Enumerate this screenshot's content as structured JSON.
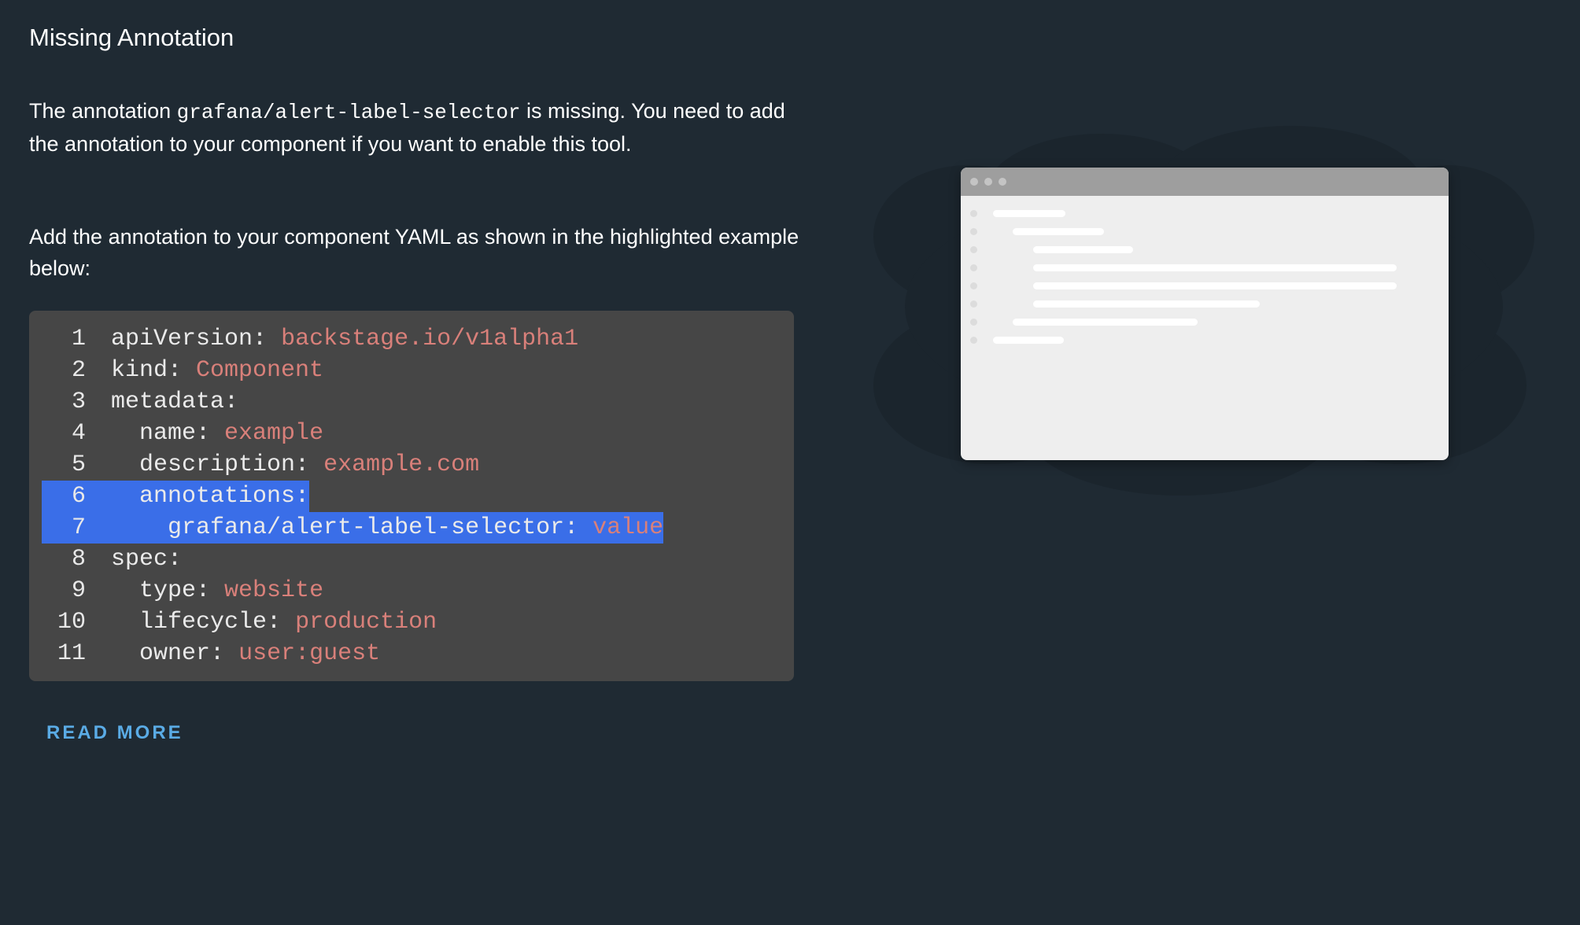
{
  "page": {
    "title": "Missing Annotation",
    "para1_before": "The annotation ",
    "para1_code": "grafana/alert-label-selector",
    "para1_after": " is missing. You need to add the annotation to your component if you want to enable this tool.",
    "para2": "Add the annotation to your component YAML as shown in the highlighted example below:",
    "read_more_label": "READ MORE"
  },
  "code": {
    "lines": [
      {
        "num": "1",
        "indent": "",
        "key": "apiVersion:",
        "value": "backstage.io/v1alpha1",
        "highlighted": false
      },
      {
        "num": "2",
        "indent": "",
        "key": "kind:",
        "value": "Component",
        "highlighted": false
      },
      {
        "num": "3",
        "indent": "",
        "key": "metadata:",
        "value": "",
        "highlighted": false
      },
      {
        "num": "4",
        "indent": "  ",
        "key": "name:",
        "value": "example",
        "highlighted": false
      },
      {
        "num": "5",
        "indent": "  ",
        "key": "description:",
        "value": "example.com",
        "highlighted": false
      },
      {
        "num": "6",
        "indent": "  ",
        "key": "annotations:",
        "value": "",
        "highlighted": true
      },
      {
        "num": "7",
        "indent": "    ",
        "key": "grafana/alert-label-selector:",
        "value": "value",
        "highlighted": true
      },
      {
        "num": "8",
        "indent": "",
        "key": "spec:",
        "value": "",
        "highlighted": false
      },
      {
        "num": "9",
        "indent": "  ",
        "key": "type:",
        "value": "website",
        "highlighted": false
      },
      {
        "num": "10",
        "indent": "  ",
        "key": "lifecycle:",
        "value": "production",
        "highlighted": false
      },
      {
        "num": "11",
        "indent": "  ",
        "key": "owner:",
        "value": "user:guest",
        "highlighted": false
      }
    ]
  },
  "colors": {
    "background": "#1f2a33",
    "code_background": "#464646",
    "highlight": "#3a6ee8",
    "value_text": "#d9807a",
    "link": "#5aabe5"
  },
  "illustration": {
    "icon": "browser-window-illustration"
  }
}
